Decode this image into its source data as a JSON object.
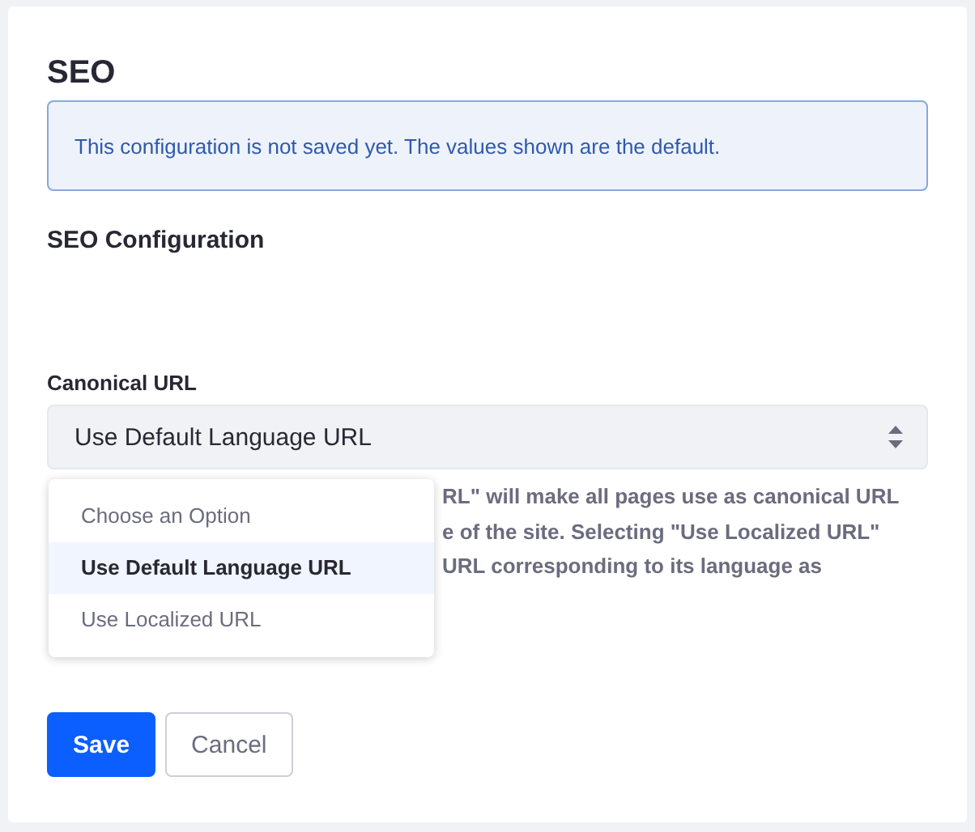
{
  "title": "SEO",
  "alert": "This configuration is not saved yet. The values shown are the default.",
  "section_title": "SEO Configuration",
  "field": {
    "label": "Canonical URL",
    "value": "Use Default Language URL"
  },
  "help_lines": [
    "RL\" will make all pages use as canonical URL",
    "e of the site. Selecting \"Use Localized URL\"",
    "URL corresponding to its language as"
  ],
  "dropdown": [
    {
      "label": "Choose an Option",
      "selected": false
    },
    {
      "label": "Use Default Language URL",
      "selected": true
    },
    {
      "label": "Use Localized URL",
      "selected": false
    }
  ],
  "buttons": [
    {
      "label": "Save",
      "kind": "primary"
    },
    {
      "label": "Cancel",
      "kind": "secondary"
    }
  ]
}
